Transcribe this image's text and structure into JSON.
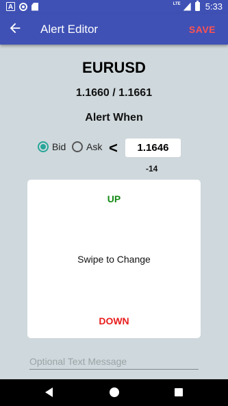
{
  "status_bar": {
    "time": "5:33",
    "network": "LTE",
    "icons": [
      "accessibility-a-icon",
      "sync-circle-icon",
      "sd-card-icon",
      "signal-icon",
      "battery-icon"
    ]
  },
  "app_bar": {
    "title": "Alert Editor",
    "save_label": "SAVE",
    "back_icon": "arrow-left-icon"
  },
  "instrument": {
    "symbol": "EURUSD",
    "quote": "1.1660 / 1.1661"
  },
  "condition": {
    "heading": "Alert When",
    "bid_label": "Bid",
    "ask_label": "Ask",
    "selected_side": "Bid",
    "operator": "<",
    "price": "1.1646",
    "pips_difference": "-14"
  },
  "swipe_card": {
    "up_label": "UP",
    "center_label": "Swipe to Change",
    "down_label": "DOWN"
  },
  "message": {
    "placeholder": "Optional Text Message",
    "value": ""
  },
  "colors": {
    "primary": "#3f51b5",
    "accent_save": "#ff5252",
    "background": "#cfd8dc",
    "radio_checked": "#26a69a",
    "up": "#138a13",
    "down": "#e81c1c"
  },
  "nav_bar": {
    "icons": [
      "nav-back-icon",
      "nav-home-icon",
      "nav-recents-icon"
    ]
  }
}
